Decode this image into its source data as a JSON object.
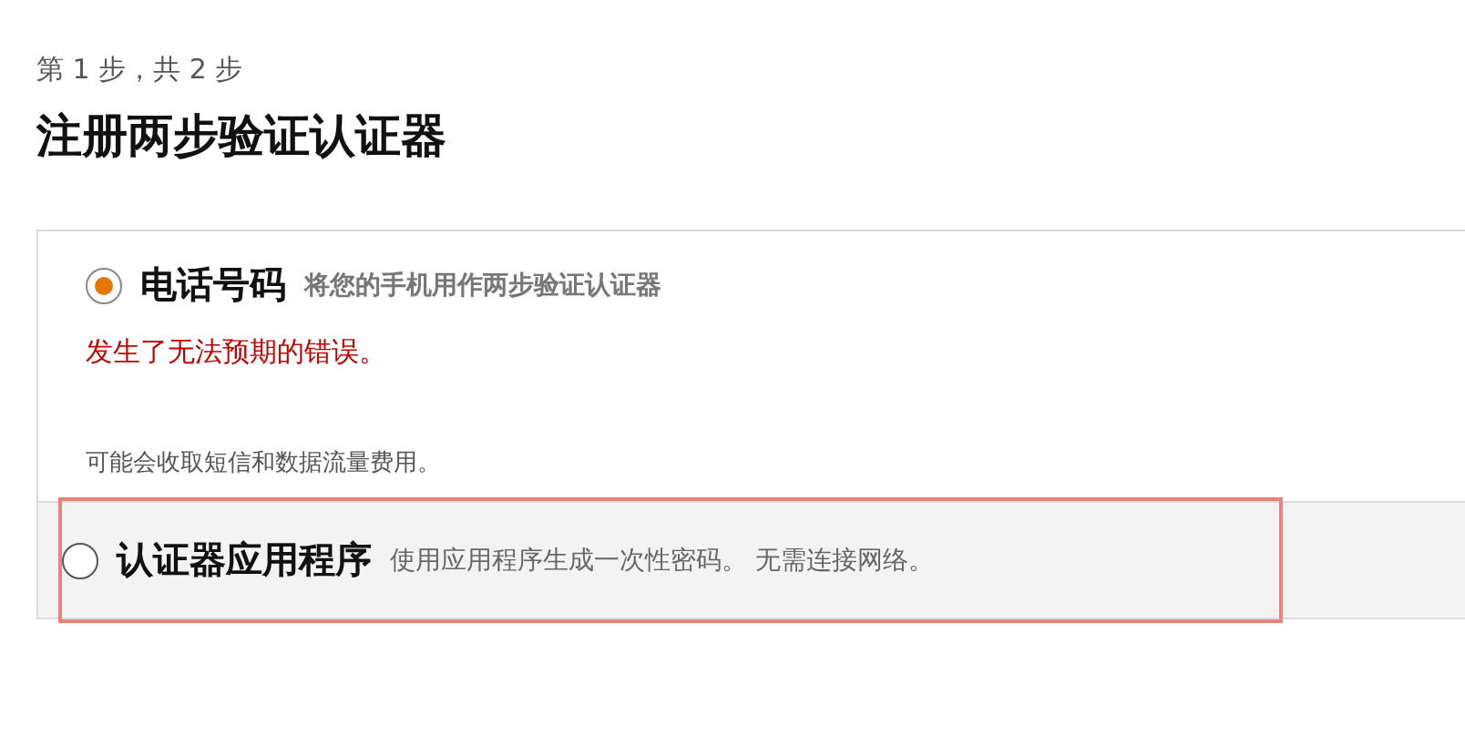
{
  "step_label": "第 1 步，共 2 步",
  "title": "注册两步验证认证器",
  "options": [
    {
      "label": "电话号码",
      "description": "将您的手机用作两步验证认证器",
      "selected": true,
      "highlighted": false,
      "error": "发生了无法预期的错误。",
      "note": "可能会收取短信和数据流量费用。"
    },
    {
      "label": "认证器应用程序",
      "description": "使用应用程序生成一次性密码。 无需连接网络。",
      "selected": false,
      "highlighted": true
    }
  ]
}
